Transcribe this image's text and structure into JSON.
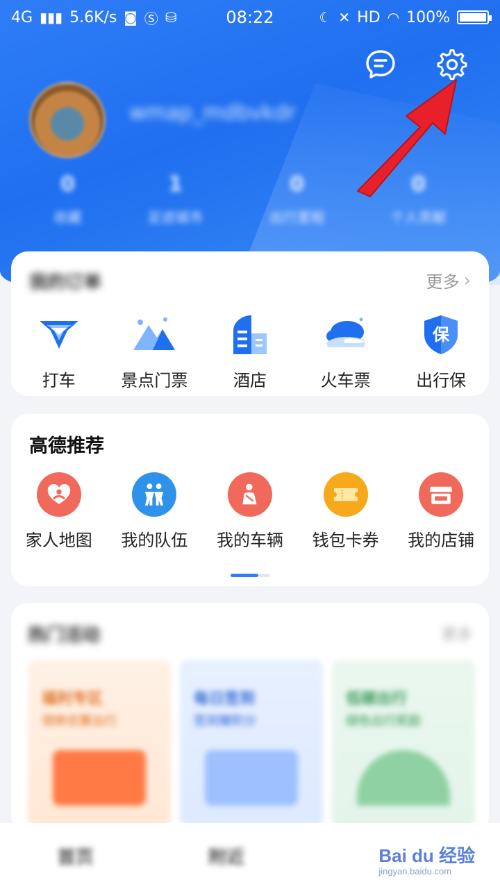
{
  "status_bar": {
    "network": "4G",
    "speed": "5.6K/s",
    "time": "08:22",
    "hd": "HD",
    "battery": "100%"
  },
  "header": {
    "username": "wmap_mdbvkdr",
    "stats": [
      {
        "num": "0",
        "label": "收藏"
      },
      {
        "num": "1",
        "label": "足迹城市"
      },
      {
        "num": "0",
        "label": "出行里程"
      },
      {
        "num": "0",
        "label": "个人贡献"
      }
    ]
  },
  "orders": {
    "title": "我的订单",
    "more": "更多",
    "items": [
      {
        "label": "打车",
        "icon": "taxi-icon"
      },
      {
        "label": "景点门票",
        "icon": "mountain-ticket-icon"
      },
      {
        "label": "酒店",
        "icon": "hotel-icon"
      },
      {
        "label": "火车票",
        "icon": "train-icon"
      },
      {
        "label": "出行保",
        "icon": "insurance-shield-icon"
      }
    ]
  },
  "recommend": {
    "title": "高德推荐",
    "items": [
      {
        "label": "家人地图",
        "icon": "family-map-icon",
        "color": "#f0695a"
      },
      {
        "label": "我的队伍",
        "icon": "team-icon",
        "color": "#2f92ea"
      },
      {
        "label": "我的车辆",
        "icon": "vehicle-icon",
        "color": "#f0695a"
      },
      {
        "label": "钱包卡券",
        "icon": "wallet-coupon-icon",
        "color": "#f7a81b"
      },
      {
        "label": "我的店铺",
        "icon": "shop-icon",
        "color": "#f0695a"
      }
    ]
  },
  "hot": {
    "title": "热门活动",
    "more": "更多",
    "tiles": [
      {
        "line1": "福利专区",
        "line2": "领券优惠出行"
      },
      {
        "line1": "每日签到",
        "line2": "签到赚积分"
      },
      {
        "line1": "低碳出行",
        "line2": "绿色出行奖励"
      }
    ]
  },
  "tabbar": {
    "tabs": [
      "首页",
      "附近"
    ]
  },
  "watermark": {
    "main": "Bai du 经验",
    "sub": "jingyan.baidu.com"
  },
  "colors": {
    "primary": "#2f7df6",
    "arrow": "#e8202a"
  }
}
